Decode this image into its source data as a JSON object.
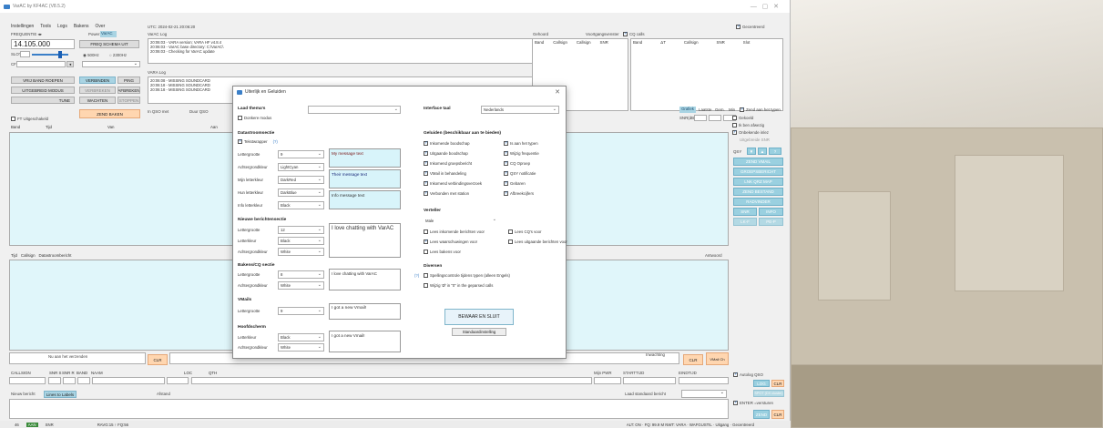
{
  "app": {
    "title": "VarAC by KF4AC (V8.5.2)"
  },
  "menu": [
    "Instellingen",
    "Tools",
    "Logs",
    "Bakens",
    "Over"
  ],
  "top": {
    "freq_label": "FREQUENTIE ◂▸",
    "frequency": "14.105.000",
    "power_label": "Power:",
    "power_value": "VarAC",
    "freq_schema_btn": "FREQ SCHEMA UIT",
    "radio_500": "500Hz",
    "radio_2300": "2300Hz",
    "slot_label": "SLOT",
    "cf_label": "CF",
    "utc": "UTC: 2024-02-21   20:06:20",
    "varac_log_label": "VarAC Log",
    "log_lines": [
      "20:06:03 - VARA version: VARA HF v4.8.4",
      "20:06:03 - VarAC base directory: C:\\VarAC\\",
      "20:06:03 - Checking for VarAC update"
    ],
    "vara_log_label": "VARA Log",
    "vara_lines": [
      "20:06:08 - MISSING SOUNDCARD",
      "20:06:18 - MISSING SOUNDCARD",
      "20:06:18 - MISSING SOUNDCARD"
    ],
    "btn_vrij_roepen": "VRIJ BAND ROEPEN",
    "btn_verbinden": "VERBINDEN",
    "btn_ping": "PING",
    "btn_uitgebreid": "UITGEBREID MODUS",
    "btn_verbreken": "VERBREKEN",
    "btn_afbreken": "AFBREKEN",
    "btn_tune": "TUNE",
    "btn_wachten": "WACHTEN",
    "btn_stoppen": "STOPPEN",
    "btn_zend_baken": "ZEND BAKEN",
    "ft_label": "FT Uitgeschakeld",
    "in_qso": "In QSO met",
    "duur": "Duur QSO"
  },
  "right": {
    "gehoord_label": "Gehoord",
    "voortgang_label": "Voortgangsvenster",
    "cq_label": "CQ calls",
    "gecentreerd": "Gecentreerd",
    "grafiek_tab": "Grafiek",
    "laatste": "Laatste",
    "gem": "Gem.",
    "min": "Min",
    "snr": "SNR(dB)",
    "zend_aan": "Zend aan het typen",
    "gekoeld": "Gekoeld",
    "ik_ben_afwezig": "Ik ben afwezig",
    "onbekende": "Onbekende inlez",
    "uitgebreide_snr": "Uitgebreide SNR",
    "qsy": "QSY",
    "btn_zend_vmail": "ZEND VMAIL",
    "btn_groepsbericht": "GROEPSBERICHT",
    "btn_lnk": "LNK QRZ MAP",
    "btn_zend_bestand": "ZEND BESTAND",
    "btn_radvinder": "RADVINDER",
    "btn_snr": "SNR",
    "btn_info": "INFO",
    "btn_lk": "LK-F",
    "btn_pe": "PE-P"
  },
  "columns": {
    "heard": [
      "Band",
      "Callsign",
      "Callsign",
      "SNR"
    ],
    "cq": [
      "Band",
      "ΔT",
      "Callsign",
      "SNR",
      "Slot"
    ],
    "main": [
      "Band",
      "Tijd",
      "Van",
      "Aan"
    ],
    "chat": [
      "Tijd",
      "Callsign",
      "Datastroombericht"
    ],
    "chat_right": "Antwoord"
  },
  "bottom": {
    "voeg_toe": "Nu aan het verzenden",
    "clr": "CLR",
    "inwachting": "Inwachting",
    "vmail": "VMail Ch",
    "fields": [
      "CALLSIGN",
      "SNR S",
      "SNR R",
      "BAND",
      "NAAM",
      "LOC",
      "QTH"
    ],
    "mijn_pwr": "Mijn PWR",
    "starttijd": "STARTTIJD",
    "eindtijd": "EINDTIJD",
    "autolog": "Autolog QSO",
    "nieuw_bericht": "Nieuw bericht",
    "lines_to_labels": "Lines to Labels",
    "afstand": "Afstand",
    "laad_standaard": "Laad standaard bericht",
    "log_btn": "LOG",
    "clr2": "CLR",
    "spot_btn": "SPOT (DX cluster)",
    "enter_versturen": "ENTER =versturen",
    "zend_btn": "ZEND",
    "clr3": "CLR"
  },
  "status": {
    "items": [
      "46",
      "AAN",
      "SNR",
      "",
      "RAVG:15 ↑  FQ:56"
    ],
    "right": "ALT: ON   · FQ: 99.9 M  NWT: VARA  · WAFGUSTIL · Uitgang · Gecentreerd"
  },
  "dialog": {
    "title": "Uiterlijk en Geluiden",
    "laad_themas": "Laad thema's",
    "donkere_modus": "Donkere modus",
    "interface_taal": "Interface taal",
    "taal_value": "Nederlands",
    "datastroom_h": "Datastroomsectie",
    "tekstwrap": "Tekstwrapper",
    "tekstwrap_info": "(?)",
    "lettergrootte": "Lettergrootte",
    "lettergrootte_val": "9",
    "achtergrondkleur": "Achtergrondkleur",
    "achtergrond_val": "LightCyan",
    "mijn_letterkleur": "Mijn letterkleur",
    "mijn_val": "DarkRed",
    "hun_letterkleur": "Hun letterkleur",
    "hun_val": "DarkBlue",
    "info_letterkleur": "Info letterkleur",
    "info_val": "Black",
    "my_message": "My message text",
    "their_message": "Their message text",
    "info_message": "Info message text",
    "nieuwe_h": "Nieuwe berichtensectie",
    "nb_lettergrootte_val": "12",
    "letterkleur": "Letterkleur",
    "nb_kleur_val": "Black",
    "nb_achter_val": "White",
    "chatting": "I love chatting with VarAC",
    "bakens_h": "Bakens/CQ sectie",
    "bk_lettergrootte_val": "8",
    "bk_achter_val": "White",
    "bk_chatting": "I love chatting with VarAC",
    "vmails_h": "VMails",
    "vm_lettergrootte_val": "9",
    "got_vmail": "I got a new Vmail!",
    "hoofd_h": "Hoofdscherm",
    "hs_kleur_val": "Black",
    "hs_achter_val": "White",
    "hs_vmail": "I got a new Vmail!",
    "geluiden_h": "Geluiden (beschikbaar aan te bieden)",
    "sounds": [
      [
        "Inkomende boodschap",
        "Is aan het typen"
      ],
      [
        "Uitgaande boodschap",
        "Wijzig frequentie"
      ],
      [
        "Inkomend groepsbericht",
        "CQ Oproep"
      ],
      [
        "VMail in behandeling",
        "QSY notificatie"
      ],
      [
        "Inkomend verbindingsverzoek",
        "Gebaren"
      ],
      [
        "Verbonden met station",
        "Afbreekcijfers"
      ]
    ],
    "verteller_h": "Verteller",
    "verteller_val": "Male",
    "verteller_opts": [
      [
        "Lees inkomende berichten voor",
        "Lees CQ's voor"
      ],
      [
        "Lees waarschuwingen voor",
        "Lees uitgaande berichten voor"
      ],
      [
        "Lees bakens voor",
        ""
      ]
    ],
    "diversen_h": "Diversen",
    "diversen_info": "(?)",
    "spelling": "Spellingscontrole tijdens typen (alleen Engels)",
    "wijzig": "Wijzig 'Ø' in \"0\" in the geparsed calls",
    "bewaar": "BEWAAR EN SLUIT",
    "standaard": "Standaardinstelling"
  }
}
